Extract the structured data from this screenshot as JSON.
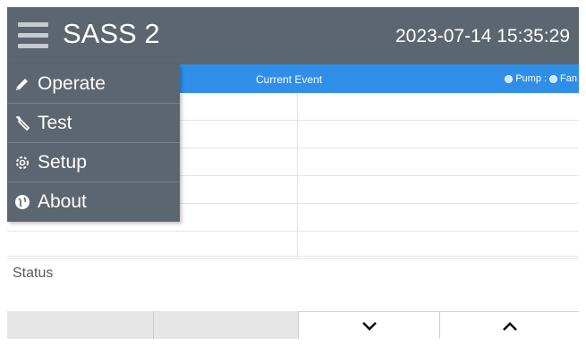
{
  "header": {
    "title": "SASS 2",
    "datetime": "2023-07-14 15:35:29"
  },
  "event_bar": {
    "current_event_label": "Current Event",
    "pump_label": "Pump",
    "separator": ":",
    "fan_label": "Fan"
  },
  "menu": {
    "items": [
      {
        "label": "Operate",
        "icon": "pencil-icon"
      },
      {
        "label": "Test",
        "icon": "wrench-icon"
      },
      {
        "label": "Setup",
        "icon": "gear-icon"
      },
      {
        "label": "About",
        "icon": "globe-icon"
      }
    ]
  },
  "status": {
    "label": "Status"
  },
  "bottom_bar": {
    "buttons": [
      {
        "label": "",
        "icon": ""
      },
      {
        "label": "",
        "icon": ""
      },
      {
        "label": "",
        "icon": "chevron-down-icon"
      },
      {
        "label": "",
        "icon": "chevron-up-icon"
      }
    ]
  }
}
